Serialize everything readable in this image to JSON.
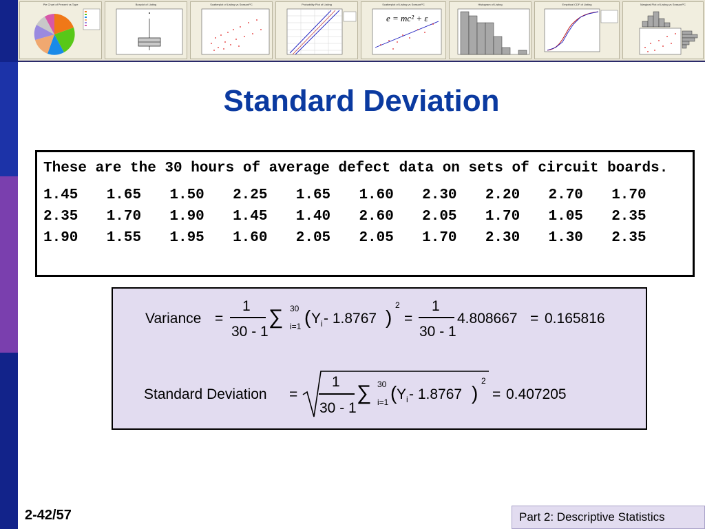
{
  "slide": {
    "title": "Standard Deviation",
    "page_number": "2-42/57",
    "footer": "Part 2: Descriptive Statistics"
  },
  "thumbnails": [
    {
      "title": "Pie Chart of Percent vs Type"
    },
    {
      "title": "Boxplot of Listing"
    },
    {
      "title": "Scatterplot of Listing vs SeasonPC"
    },
    {
      "title": "Probability Plot of Listing"
    },
    {
      "title": "Scatterplot of Listing vs SeasonPC",
      "equation": "e = mc² + ε"
    },
    {
      "title": "Histogram of Listing"
    },
    {
      "title": "Empirical CDF of Listing"
    },
    {
      "title": "Marginal Plot of Listing vs SeasonPC"
    }
  ],
  "data_box": {
    "intro": "These are the 30 hours of average defect data on sets of circuit boards.",
    "rows": [
      [
        "1.45",
        "1.65",
        "1.50",
        "2.25",
        "1.65",
        "1.60",
        "2.30",
        "2.20",
        "2.70",
        "1.70"
      ],
      [
        "2.35",
        "1.70",
        "1.90",
        "1.45",
        "1.40",
        "2.60",
        "2.05",
        "1.70",
        "1.05",
        "2.35"
      ],
      [
        "1.90",
        "1.55",
        "1.95",
        "1.60",
        "2.05",
        "2.05",
        "1.70",
        "2.30",
        "1.30",
        "2.35"
      ]
    ]
  },
  "formulas": {
    "variance": {
      "label": "Variance",
      "eq": "=",
      "frac_num": "1",
      "frac_den": "30 - 1",
      "sigma": "∑",
      "sum_upper": "30",
      "sum_lower": "i=1",
      "lparen": "(",
      "rparen": ")",
      "y": "Y",
      "sub": "i",
      "minus_mean": " - 1.8767",
      "power": "2",
      "eq2": "=",
      "frac2_num": "1",
      "frac2_den": "30 - 1",
      "sum_value": "4.808667",
      "eq3": "=",
      "result": "0.165816"
    },
    "stddev": {
      "label": "Standard Deviation",
      "eq": "=",
      "frac_num": "1",
      "frac_den": "30 - 1",
      "sigma": "∑",
      "sum_upper": "30",
      "sum_lower": "i=1",
      "lparen": "(",
      "rparen": ")",
      "y": "Y",
      "sub": "i",
      "minus_mean": " - 1.8767",
      "power": "2",
      "eq2": "=",
      "result": "0.407205"
    }
  },
  "colors": {
    "title": "#0b3aa0",
    "formula_bg": "#e2dcf0",
    "sidebar": [
      "#12238a",
      "#1c33a8",
      "#7a3fae",
      "#12238a"
    ]
  }
}
